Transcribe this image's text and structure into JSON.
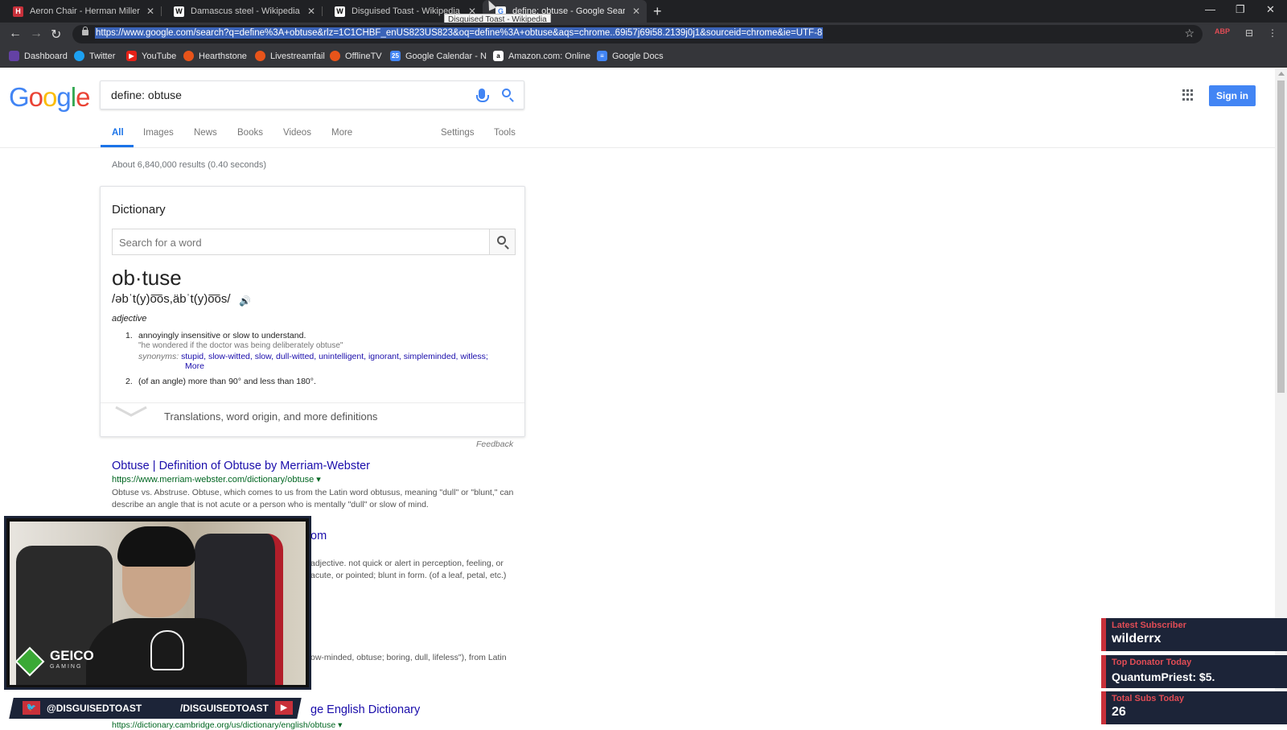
{
  "tabs": [
    {
      "title": "Aeron Chair - Herman Miller",
      "favicon": "H",
      "favicon_color": "#c8303a"
    },
    {
      "title": "Damascus steel - Wikipedia",
      "favicon": "W",
      "favicon_color": "#ffffff"
    },
    {
      "title": "Disguised Toast - Wikipedia",
      "favicon": "W",
      "favicon_color": "#ffffff"
    },
    {
      "title": "define: obtuse - Google Search",
      "favicon": "G",
      "favicon_color": "#4285f4"
    }
  ],
  "tooltip": "Disguised Toast - Wikipedia",
  "url": "https://www.google.com/search?q=define%3A+obtuse&rlz=1C1CHBF_enUS823US823&oq=define%3A+obtuse&aqs=chrome..69i57j69i58.2139j0j1&sourceid=chrome&ie=UTF-8",
  "bookmarks": [
    {
      "label": "Dashboard",
      "icon": "twitch-icon",
      "color": "#6441a5"
    },
    {
      "label": "Twitter",
      "icon": "twitter-icon",
      "color": "#1da1f2"
    },
    {
      "label": "YouTube",
      "icon": "youtube-icon",
      "color": "#e62117"
    },
    {
      "label": "Hearthstone",
      "icon": "reddit-icon",
      "color": "#e8541a"
    },
    {
      "label": "Livestreamfail",
      "icon": "reddit-icon",
      "color": "#e8541a"
    },
    {
      "label": "OfflineTV",
      "icon": "reddit-icon",
      "color": "#e8541a"
    },
    {
      "label": "Google Calendar - N",
      "icon": "calendar-icon",
      "color": "#4285f4"
    },
    {
      "label": "Amazon.com: Online",
      "icon": "amazon-icon",
      "color": "#ffffff"
    },
    {
      "label": "Google Docs",
      "icon": "docs-icon",
      "color": "#4285f4"
    }
  ],
  "google": {
    "query": "define: obtuse",
    "sign_in": "Sign in",
    "nav": [
      "All",
      "Images",
      "News",
      "Books",
      "Videos",
      "More"
    ],
    "nav_right": [
      "Settings",
      "Tools"
    ],
    "stats": "About 6,840,000 results (0.40 seconds)"
  },
  "dictionary": {
    "heading": "Dictionary",
    "search_placeholder": "Search for a word",
    "word": "ob·tuse",
    "pronunciation": "/əbˈt(y)o͞os,äbˈt(y)o͞os/",
    "part_of_speech": "adjective",
    "def1_num": "1.",
    "def1": "annoyingly insensitive or slow to understand.",
    "def1_example": "\"he wondered if the doctor was being deliberately obtuse\"",
    "synonyms_label": "synonyms:",
    "synonyms": "stupid, slow-witted, slow, dull-witted, unintelligent, ignorant, simpleminded, witless;",
    "synonyms_more": "More",
    "def2_num": "2.",
    "def2": "(of an angle) more than 90° and less than 180°.",
    "more_link": "Translations, word origin, and more definitions",
    "feedback": "Feedback"
  },
  "results": [
    {
      "title": "Obtuse | Definition of Obtuse by Merriam-Webster",
      "url": "https://www.merriam-webster.com/dictionary/obtuse ▾",
      "snippet": "Obtuse vs. Abstruse. Obtuse, which comes to us from the Latin word obtusus, meaning \"dull\" or \"blunt,\" can describe an angle that is not acute or a person who is mentally \"dull\" or slow of mind."
    }
  ],
  "fragments": {
    "link2_tail": "om",
    "snip2_line1": "adjective. not quick or alert in perception, feeling, or",
    "snip2_line2": "acute, or pointed; blunt in form. (of a leaf, petal, etc.)",
    "snip3_line": "ow-minded, obtuse; boring, dull, lifeless\"), from Latin",
    "link4_tail": "ge English Dictionary",
    "url4_tail": "https://dictionary.cambridge.org/us/dictionary/english/obtuse ▾"
  },
  "overlay": {
    "sponsor": "GEICO",
    "sponsor_sub": "GAMING",
    "twitter": "@DISGUISEDTOAST",
    "youtube": "/DISGUISEDTOAST",
    "latest_sub_label": "Latest Subscriber",
    "latest_sub": "wilderrx",
    "top_donator_label": "Top Donator Today",
    "top_donator": "QuantumPriest: $5.",
    "total_subs_label": "Total Subs Today",
    "total_subs": "26"
  }
}
